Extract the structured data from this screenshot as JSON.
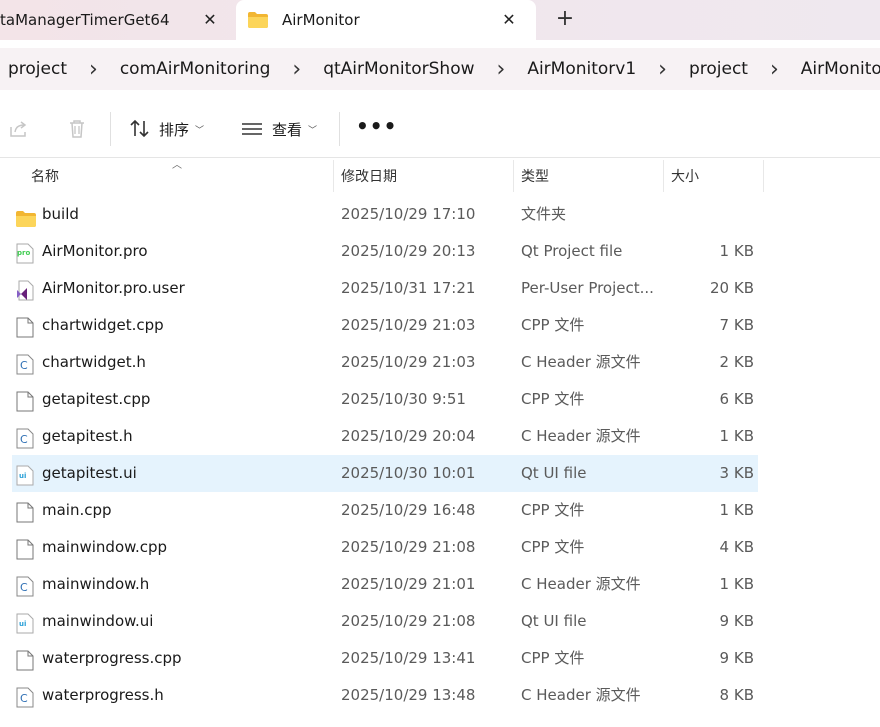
{
  "tabs": [
    {
      "label": "taManagerTimerGet64",
      "active": false
    },
    {
      "label": "AirMonitor",
      "active": true
    }
  ],
  "breadcrumb": [
    "project",
    "comAirMonitoring",
    "qtAirMonitorShow",
    "AirMonitorv1",
    "project",
    "AirMonitor"
  ],
  "toolbar": {
    "sort_label": "排序",
    "view_label": "查看",
    "more_label": "•••"
  },
  "columns": {
    "name": "名称",
    "date": "修改日期",
    "type": "类型",
    "size": "大小"
  },
  "files": [
    {
      "name": "build",
      "date": "2025/10/29 17:10",
      "type": "文件夹",
      "size": "",
      "icon": "folder-icon"
    },
    {
      "name": "AirMonitor.pro",
      "date": "2025/10/29 20:13",
      "type": "Qt Project file",
      "size": "1 KB",
      "icon": "qt-pro-icon"
    },
    {
      "name": "AirMonitor.pro.user",
      "date": "2025/10/31 17:21",
      "type": "Per-User Project...",
      "size": "20 KB",
      "icon": "visual-studio-icon"
    },
    {
      "name": "chartwidget.cpp",
      "date": "2025/10/29 21:03",
      "type": "CPP 文件",
      "size": "7 KB",
      "icon": "file-icon"
    },
    {
      "name": "chartwidget.h",
      "date": "2025/10/29 21:03",
      "type": "C Header 源文件",
      "size": "2 KB",
      "icon": "c-header-icon"
    },
    {
      "name": "getapitest.cpp",
      "date": "2025/10/30 9:51",
      "type": "CPP 文件",
      "size": "6 KB",
      "icon": "file-icon"
    },
    {
      "name": "getapitest.h",
      "date": "2025/10/29 20:04",
      "type": "C Header 源文件",
      "size": "1 KB",
      "icon": "c-header-icon"
    },
    {
      "name": "getapitest.ui",
      "date": "2025/10/30 10:01",
      "type": "Qt UI file",
      "size": "3 KB",
      "icon": "qt-ui-icon",
      "selected": true
    },
    {
      "name": "main.cpp",
      "date": "2025/10/29 16:48",
      "type": "CPP 文件",
      "size": "1 KB",
      "icon": "file-icon"
    },
    {
      "name": "mainwindow.cpp",
      "date": "2025/10/29 21:08",
      "type": "CPP 文件",
      "size": "4 KB",
      "icon": "file-icon"
    },
    {
      "name": "mainwindow.h",
      "date": "2025/10/29 21:01",
      "type": "C Header 源文件",
      "size": "1 KB",
      "icon": "c-header-icon"
    },
    {
      "name": "mainwindow.ui",
      "date": "2025/10/29 21:08",
      "type": "Qt UI file",
      "size": "9 KB",
      "icon": "qt-ui-icon"
    },
    {
      "name": "waterprogress.cpp",
      "date": "2025/10/29 13:41",
      "type": "CPP 文件",
      "size": "9 KB",
      "icon": "file-icon"
    },
    {
      "name": "waterprogress.h",
      "date": "2025/10/29 13:48",
      "type": "C Header 源文件",
      "size": "8 KB",
      "icon": "c-header-icon"
    }
  ],
  "colors": {
    "selection": "#e5f3fd",
    "folder": "#f7c948",
    "qt_green": "#41cd52"
  }
}
